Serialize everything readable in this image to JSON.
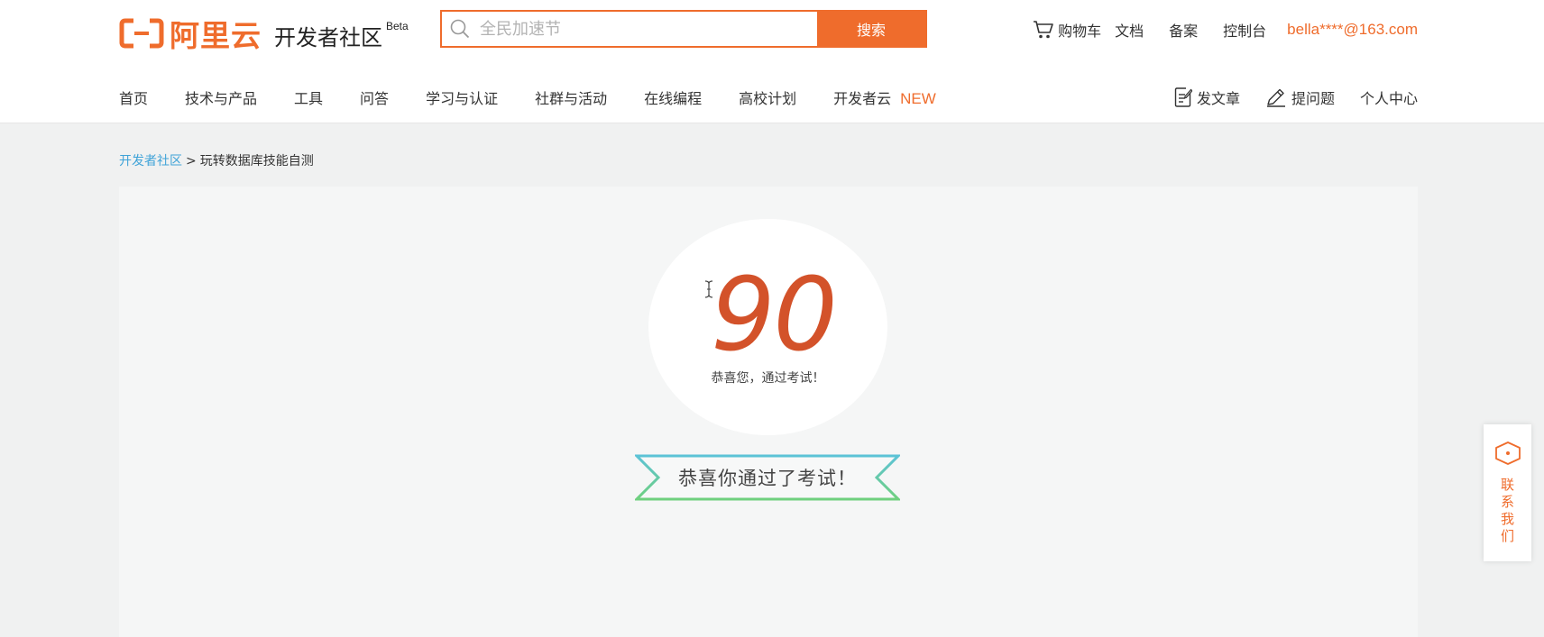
{
  "header": {
    "logo": {
      "brand": "阿里云",
      "sub": "开发者社区",
      "beta": "Beta"
    },
    "search": {
      "placeholder": "全民加速节",
      "value": "",
      "button_label": "搜索"
    },
    "top_links": {
      "cart": "购物车",
      "docs": "文档",
      "filing": "备案",
      "console": "控制台",
      "user": "bella****@163.com"
    },
    "nav": [
      {
        "label": "首页"
      },
      {
        "label": "技术与产品"
      },
      {
        "label": "工具"
      },
      {
        "label": "问答"
      },
      {
        "label": "学习与认证"
      },
      {
        "label": "社群与活动"
      },
      {
        "label": "在线编程"
      },
      {
        "label": "高校计划"
      },
      {
        "label": "开发者云",
        "badge": "NEW"
      }
    ],
    "nav_right": {
      "write_article": "发文章",
      "ask_question": "提问题",
      "personal_center": "个人中心"
    },
    "accent_color": "#ef6c2c"
  },
  "breadcrumb": {
    "root": "开发者社区",
    "separator": ">",
    "current": "玩转数据库技能自测"
  },
  "result": {
    "score": "90",
    "score_message": "恭喜您，通过考试！",
    "ribbon_text": "恭喜你通过了考试！",
    "score_color": "#d3522a"
  },
  "contact": {
    "label": "联系我们"
  },
  "icons": {
    "search": "search-icon",
    "cart": "cart-icon",
    "write": "document-edit-icon",
    "ask": "pencil-icon",
    "contact": "hexagon-chat-icon",
    "cursor": "text-cursor-icon"
  }
}
